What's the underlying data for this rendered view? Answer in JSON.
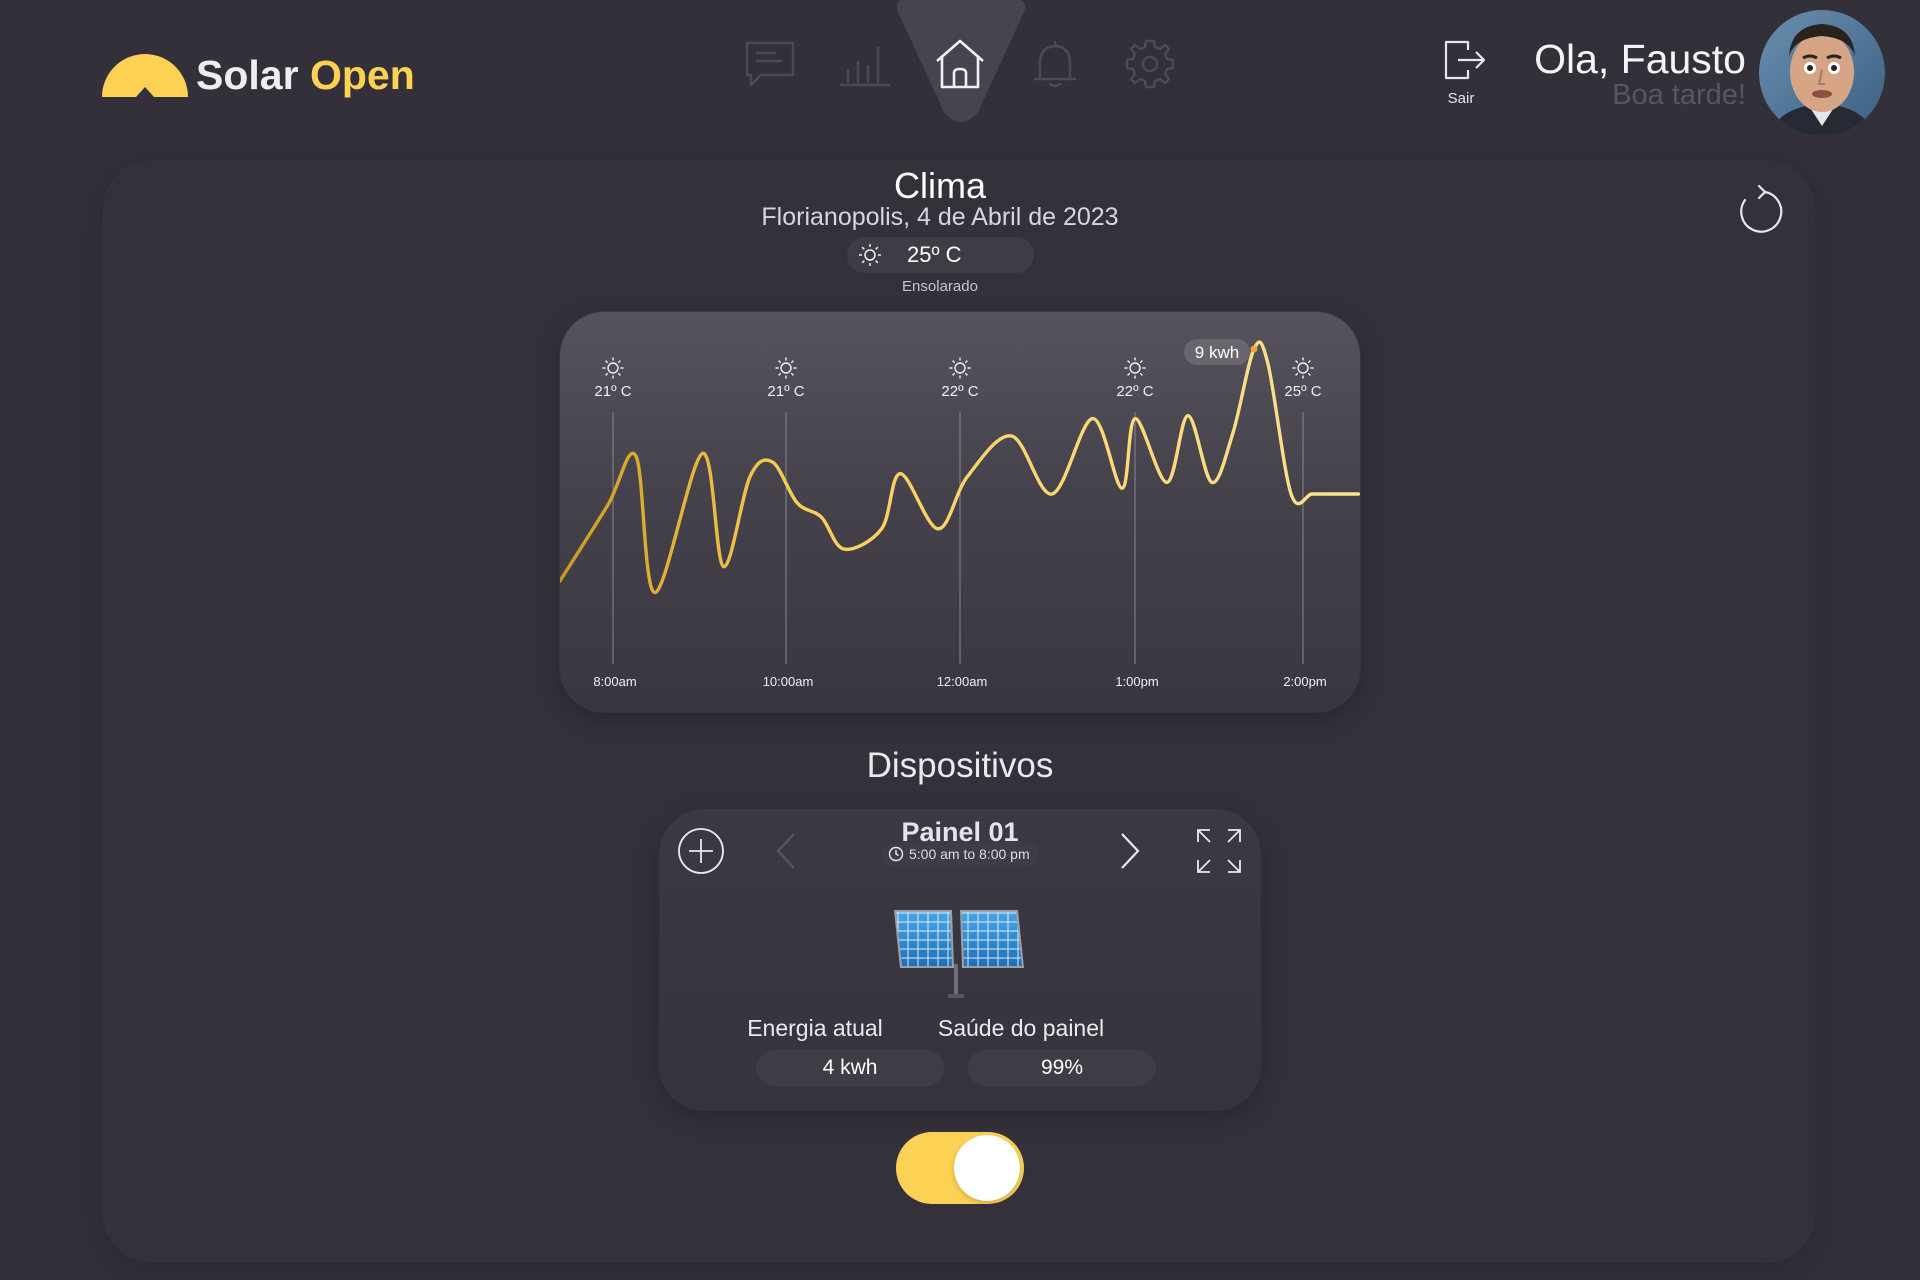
{
  "brand": {
    "word1": "Solar",
    "word2": "Open",
    "accent_color": "#fdd254"
  },
  "nav": {
    "items": [
      {
        "name": "chat-icon",
        "active": false
      },
      {
        "name": "bar-chart-icon",
        "active": false
      },
      {
        "name": "home-icon",
        "active": true
      },
      {
        "name": "bell-icon",
        "active": false
      },
      {
        "name": "gear-icon",
        "active": false
      }
    ]
  },
  "header": {
    "logout_label": "Sair",
    "greeting": "Ola, Fausto",
    "sub_greeting": "Boa tarde!"
  },
  "weather": {
    "title": "Clima",
    "subtitle": "Florianopolis, 4 de Abril de 2023",
    "temperature": "25º C",
    "condition": "Ensolarado",
    "icon": "sun-icon"
  },
  "chart_data": {
    "type": "line",
    "peak_label": "9 kwh",
    "columns": [
      {
        "time": "8:00am",
        "temp": "21º C",
        "icon": "sun-icon"
      },
      {
        "time": "10:00am",
        "temp": "21º C",
        "icon": "sun-icon"
      },
      {
        "time": "12:00am",
        "temp": "22º C",
        "icon": "sun-icon"
      },
      {
        "time": "1:00pm",
        "temp": "22º C",
        "icon": "sun-icon"
      },
      {
        "time": "2:00pm",
        "temp": "25º C",
        "icon": "sun-icon"
      }
    ],
    "series": [
      {
        "color": "#fbd56a",
        "x": [
          0,
          0.125,
          0.2,
          0.25,
          0.375,
          0.43,
          0.5,
          0.56,
          0.625,
          0.69,
          0.75,
          0.85,
          0.9,
          1.0,
          1.08,
          1.2,
          1.31,
          1.42,
          1.5,
          1.55,
          1.67,
          1.75,
          1.84,
          1.92,
          2.0,
          2.06,
          2.16,
          2.25,
          2.33,
          2.41,
          2.45
        ],
        "y": [
          1.0,
          3.6,
          5.3,
          0.6,
          5.4,
          1.5,
          4.6,
          5.1,
          3.7,
          3.2,
          2.1,
          2.8,
          4.7,
          2.8,
          4.6,
          6.0,
          4.0,
          6.6,
          4.2,
          6.6,
          4.4,
          6.7,
          4.4,
          6.1,
          9.0,
          8.5,
          4.0,
          4.0,
          4.0,
          4.0,
          4.0
        ]
      }
    ],
    "x_ticks": [
      "8:00am",
      "10:00am",
      "12:00am",
      "1:00pm",
      "2:00pm"
    ]
  },
  "devices": {
    "title": "Dispositivos",
    "panel": {
      "name": "Painel 01",
      "schedule": "5:00 am to 8:00 pm",
      "energy_label": "Energia atual",
      "energy_value": "4 kwh",
      "health_label": "Saúde do painel",
      "health_value": "99%"
    },
    "power_on": true
  }
}
